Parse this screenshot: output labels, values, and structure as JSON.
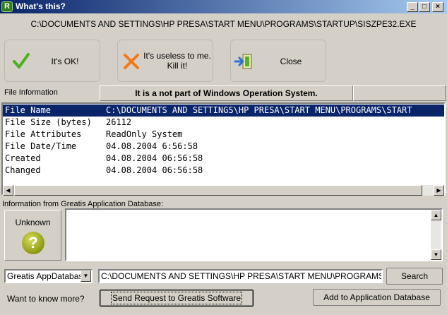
{
  "window": {
    "title": "What's this?",
    "app_icon_glyph": "R",
    "min_glyph": "_",
    "max_glyph": "□",
    "close_glyph": "×"
  },
  "file_path": "C:\\DOCUMENTS AND SETTINGS\\HP PRESA\\START MENU\\PROGRAMS\\STARTUP\\SISZPE32.EXE",
  "actions": {
    "ok_label": "It's OK!",
    "kill_label_1": "It's useless to me.",
    "kill_label_2": "Kill it!",
    "close_label": "Close"
  },
  "file_info": {
    "section_label": "File Information",
    "notice": "It is a not part of Windows Operation System.",
    "rows": [
      {
        "key": "File Name",
        "value": "C:\\DOCUMENTS AND SETTINGS\\HP PRESA\\START MENU\\PROGRAMS\\START"
      },
      {
        "key": "File Size (bytes)",
        "value": "26112"
      },
      {
        "key": "File Attributes",
        "value": "ReadOnly System"
      },
      {
        "key": "File Date/Time",
        "value": "04.08.2004 6:56:58"
      },
      {
        "key": "Created",
        "value": "04.08.2004 06:56:58"
      },
      {
        "key": "Changed",
        "value": "04.08.2004 06:56:58"
      }
    ]
  },
  "database": {
    "section_label": "Information from Greatis Application Database:",
    "status_label": "Unknown",
    "status_glyph": "?",
    "selected_source": "Greatis AppDatabase",
    "path_value": "C:\\DOCUMENTS AND SETTINGS\\HP PRESA\\START MENU\\PROGRAMS\\STAR",
    "search_label": "Search",
    "want_more_label": "Want to know more?",
    "send_request_label": "Send Request to Greatis Software",
    "add_label": "Add to Application Database"
  },
  "colors": {
    "selection": "#0a246a",
    "ok_check": "#4caf1e",
    "kill_x": "#f07a18",
    "question": "#9aa812"
  }
}
